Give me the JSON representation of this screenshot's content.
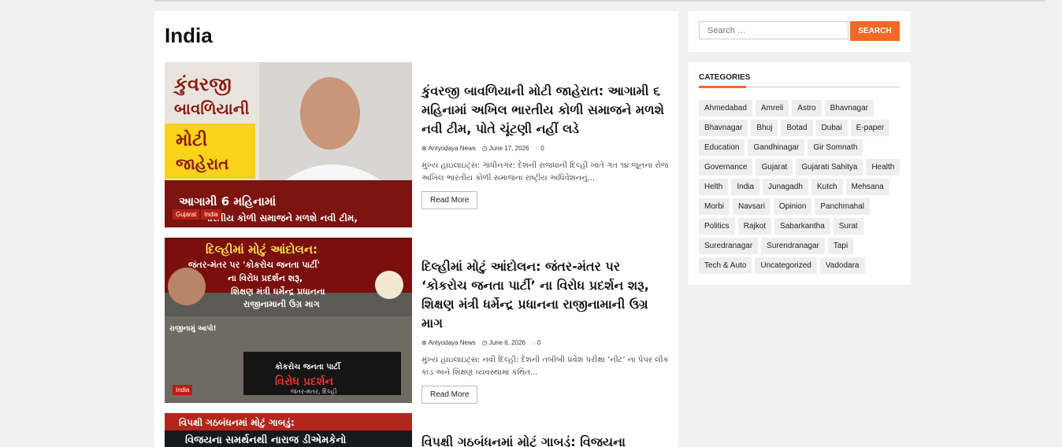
{
  "main": {
    "title": "India",
    "posts": [
      {
        "title": "કુંવરજી બાવળિયાની મોટી જાહેરાત: આગામી ૬ મહિનામાં અખિલ ભારતીય કોળી સમાજને મળશે નવી ટીમ, પોતે ચૂંટણી નહીં લડે",
        "author": "Antyodaya News",
        "date": "June 17, 2026",
        "comments": "0",
        "excerpt": "મુખ્ય હાઇલાઇટ્સ: ગાંધીનગર: દેશની રાજધાની દિલ્હી ખાતે ગત ૧૪ જૂનના રોજ અખિલ ભારતીય કોળી સમાજના રાષ્ટ્રીય અધિવેશનનું...",
        "read_more": "Read More",
        "categories": [
          "Gujarat",
          "India"
        ],
        "thumb_text": [
          "કુંવરજી",
          "બાવળિયાની",
          "મોટી",
          "જાહેરાત",
          "આગામી 6 મહિનામાં",
          "ભારતીય કોળી સમાજને મળશે નવી ટીમ,"
        ]
      },
      {
        "title": "દિલ્હીમાં મોટું આંદોલન: જંતર-મંતર પર ‘કોકરોચ જનતા પાર્ટી’ ના વિરોધ પ્રદર્શન શરૂ, શિક્ષણ મંત્રી ધર્મેન્દ્ર પ્રધાનના રાજીનામાની ઉગ્ર માગ",
        "author": "Antyodaya News",
        "date": "June 6, 2026",
        "comments": "0",
        "excerpt": "મુખ્ય હાઇલાઇટ્સ: નવી દિલ્હી: દેશની તબીબી પ્રવેશ પરીક્ષા ‘નીટ’ ના પેપર લીક કાંડ અને શિક્ષણ વ્યવસ્થામાં કથિત...",
        "read_more": "Read More",
        "categories": [
          "India"
        ],
        "thumb_text": [
          "દિલ્હીમાં મોટું આંદોલન:",
          "જંતર-મંતર પર 'કોકરોચ જનતા પાર્ટી'",
          "ના વિરોધ પ્રદર્શન શરૂ,",
          "શિક્ષણ મંત્રી ધર્મેન્દ્ર પ્રધાનના",
          "રાજીનામાની ઉગ્ર માગ",
          "રાજીનામું આપો!",
          "કોકરોચ જનતા પાર્ટી",
          "વિરોધ પ્રદર્શન",
          "જંતર-મંતર, દિલ્હી"
        ]
      },
      {
        "title": "વિપક્ષી ગઠબંધનમાં મોટું ગાબડું: વિજયના",
        "thumb_text": [
          "વિપક્ષી ગઠબંધનમાં મોટું ગાબડું:",
          "વિજયના સમર્થનથી નારાજ ડીએમકેનો"
        ]
      }
    ]
  },
  "sidebar": {
    "search_placeholder": "Search …",
    "search_button": "SEARCH",
    "categories_heading": "CATEGORIES",
    "categories": [
      "Ahmedabad",
      "Amreli",
      "Astro",
      "Bhavnagar",
      "Bhavnagar",
      "Bhuj",
      "Botad",
      "Dubai",
      "E-paper",
      "Education",
      "Gandhinagar",
      "Gir Somnath",
      "Governance",
      "Gujarat",
      "Gujarati Sahitya",
      "Health",
      "Helth",
      "India",
      "Junagadh",
      "Kutch",
      "Mehsana",
      "Morbi",
      "Navsari",
      "Opinion",
      "Panchmahal",
      "Politics",
      "Rajkot",
      "Sabarkantha",
      "Surat",
      "Suredranagar",
      "Surendranagar",
      "Tapi",
      "Tech & Auto",
      "Uncategorized",
      "Vadodara"
    ]
  },
  "colors": {
    "accent": "#f06a26",
    "tag_red": "#b71f14"
  }
}
